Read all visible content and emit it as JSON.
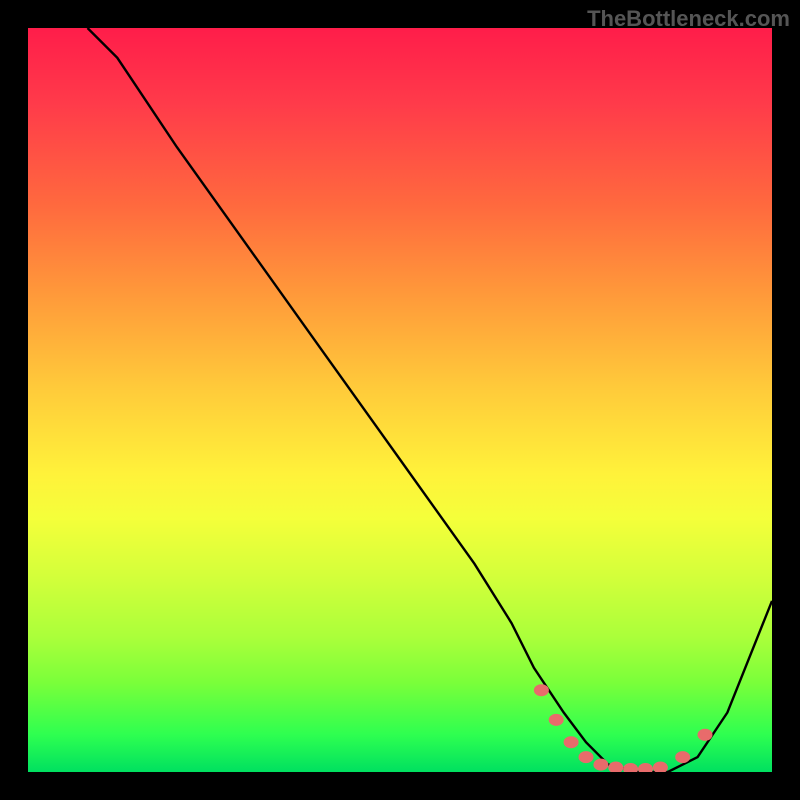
{
  "watermark": "TheBottleneck.com",
  "chart_data": {
    "type": "line",
    "title": "",
    "xlabel": "",
    "ylabel": "",
    "xlim": [
      0,
      100
    ],
    "ylim": [
      0,
      100
    ],
    "grid": false,
    "legend": false,
    "background_gradient": {
      "orientation": "vertical",
      "stops": [
        {
          "pos": 0.0,
          "color": "#ff1d4a"
        },
        {
          "pos": 0.5,
          "color": "#fff23a"
        },
        {
          "pos": 1.0,
          "color": "#00e060"
        }
      ]
    },
    "series": [
      {
        "name": "curve",
        "x": [
          8,
          12,
          20,
          30,
          40,
          50,
          60,
          65,
          68,
          72,
          75,
          78,
          82,
          86,
          90,
          94,
          100
        ],
        "y": [
          100,
          96,
          84,
          70,
          56,
          42,
          28,
          20,
          14,
          8,
          4,
          1,
          0,
          0,
          2,
          8,
          23
        ]
      }
    ],
    "markers": {
      "description": "pink dots along the valley of the curve",
      "x": [
        69,
        71,
        73,
        75,
        77,
        79,
        81,
        83,
        85,
        88,
        91
      ],
      "y": [
        11,
        7,
        4,
        2,
        1,
        0.6,
        0.4,
        0.4,
        0.6,
        2,
        5
      ]
    }
  }
}
